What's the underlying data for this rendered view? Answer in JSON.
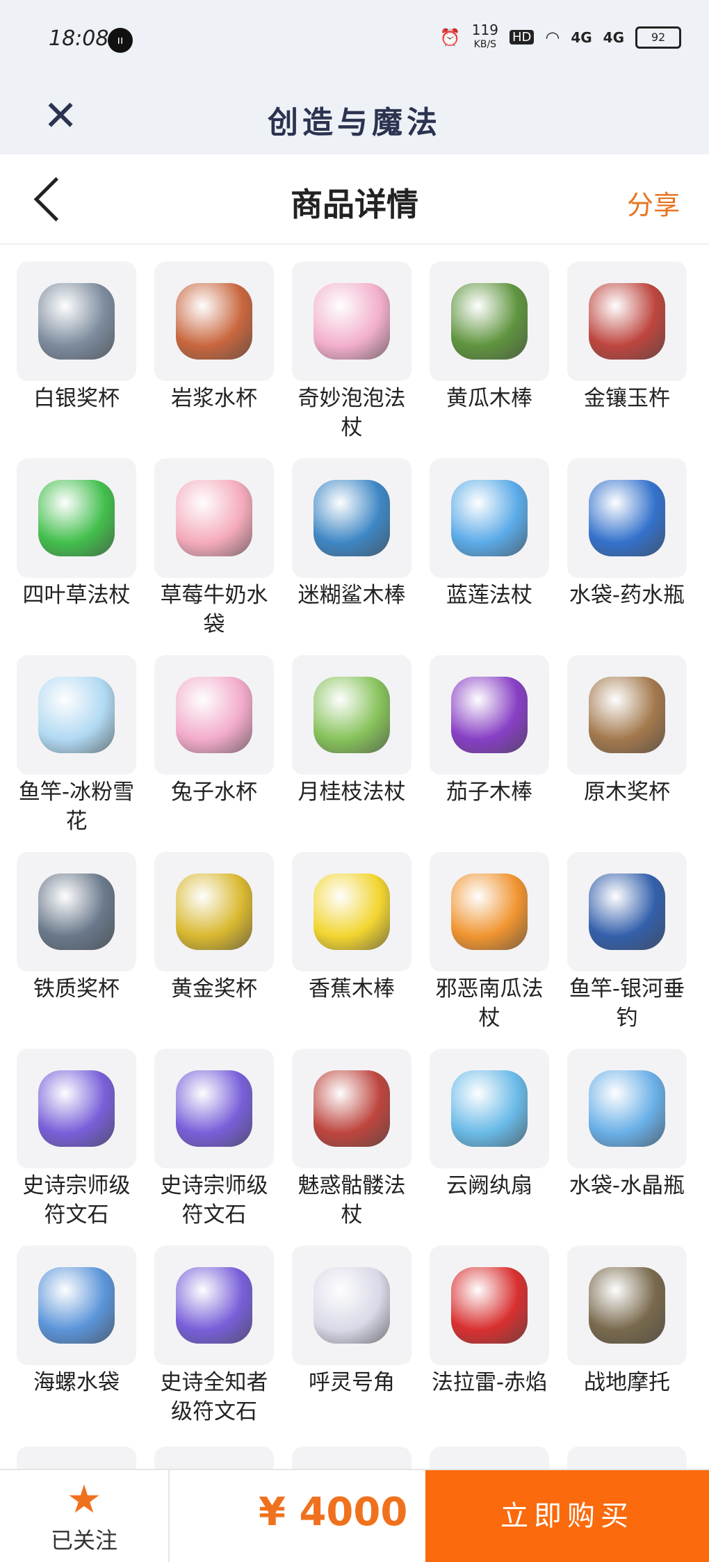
{
  "status_bar": {
    "time": "18:08",
    "net_speed": "119",
    "net_unit": "KB/S",
    "hd": "HD",
    "signal1": "4G",
    "signal2": "4G",
    "battery": "92"
  },
  "app_bar": {
    "title": "创造与魔法"
  },
  "nav": {
    "title": "商品详情",
    "share": "分享"
  },
  "items": [
    {
      "name": "白银奖杯",
      "color": "#6f8094"
    },
    {
      "name": "岩浆水杯",
      "color": "#c4572a"
    },
    {
      "name": "奇妙泡泡法杖",
      "color": "#f2a7c8"
    },
    {
      "name": "黄瓜木棒",
      "color": "#4f8a2a"
    },
    {
      "name": "金镶玉杵",
      "color": "#b8322a"
    },
    {
      "name": "四叶草法杖",
      "color": "#2fb93a"
    },
    {
      "name": "草莓牛奶水袋",
      "color": "#f5a3b5"
    },
    {
      "name": "迷糊鲨木棒",
      "color": "#2a7bbf"
    },
    {
      "name": "蓝莲法杖",
      "color": "#4aa3e6"
    },
    {
      "name": "水袋-药水瓶",
      "color": "#1e63c7"
    },
    {
      "name": "鱼竿-冰粉雪花",
      "color": "#a9d6f2"
    },
    {
      "name": "兔子水杯",
      "color": "#f2a3c6"
    },
    {
      "name": "月桂枝法杖",
      "color": "#7bbd4a"
    },
    {
      "name": "茄子木棒",
      "color": "#7b2bbf"
    },
    {
      "name": "原木奖杯",
      "color": "#9a6b3a"
    },
    {
      "name": "铁质奖杯",
      "color": "#5a6b7f"
    },
    {
      "name": "黄金奖杯",
      "color": "#d6b21a"
    },
    {
      "name": "香蕉木棒",
      "color": "#f2d21a"
    },
    {
      "name": "邪恶南瓜法杖",
      "color": "#f08a1a"
    },
    {
      "name": "鱼竿-银河垂钓",
      "color": "#1e4fa3"
    },
    {
      "name": "史诗宗师级符文石",
      "color": "#6b4fd6"
    },
    {
      "name": "史诗宗师级符文石",
      "color": "#6b4fd6"
    },
    {
      "name": "魅惑骷髅法杖",
      "color": "#b8322a"
    },
    {
      "name": "云阙纨扇",
      "color": "#5ab4e6"
    },
    {
      "name": "水袋-水晶瓶",
      "color": "#5aa8e6"
    },
    {
      "name": "海螺水袋",
      "color": "#4a8ad6"
    },
    {
      "name": "史诗全知者级符文石",
      "color": "#6b4fd6"
    },
    {
      "name": "呼灵号角",
      "color": "#d6d6e6"
    },
    {
      "name": "法拉雷-赤焰",
      "color": "#d61a1a"
    },
    {
      "name": "战地摩托",
      "color": "#6b5a3a"
    }
  ],
  "bottom": {
    "follow_label": "已关注",
    "price": "¥ 4000",
    "buy_label": "立即购买"
  }
}
